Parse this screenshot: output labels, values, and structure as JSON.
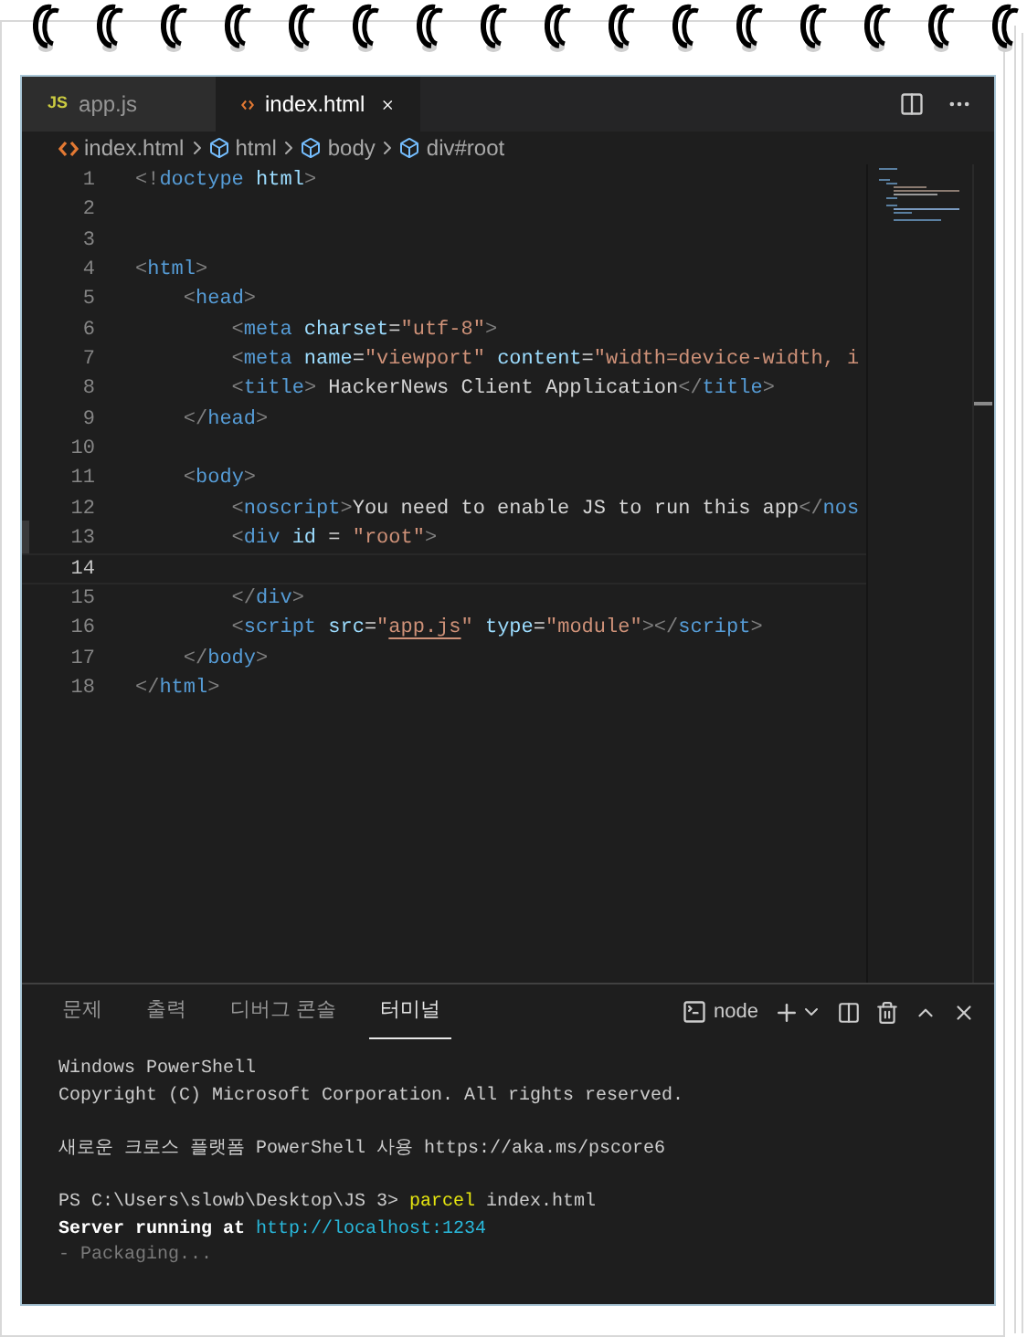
{
  "editor_tabs": [
    {
      "icon": "JS",
      "kind": "js",
      "label": "app.js",
      "selected": false
    },
    {
      "kind": "html",
      "label": "index.html",
      "selected": true
    }
  ],
  "breadcrumb": [
    {
      "kind": "file",
      "label": "index.html"
    },
    {
      "kind": "element",
      "label": "html"
    },
    {
      "kind": "element",
      "label": "body"
    },
    {
      "kind": "element",
      "label": "div#root"
    }
  ],
  "code_lines": [
    {
      "number": "1",
      "current": false,
      "tokens": [
        {
          "kind": "punct",
          "text": "<!"
        },
        {
          "kind": "tag",
          "text": "doctype"
        },
        {
          "kind": "attr",
          "text": " html"
        },
        {
          "kind": "punct",
          "text": ">"
        }
      ]
    },
    {
      "number": "2",
      "current": false
    },
    {
      "number": "3",
      "current": false
    },
    {
      "number": "4",
      "current": false,
      "tokens": [
        {
          "kind": "punct",
          "text": "<"
        },
        {
          "kind": "tag",
          "text": "html"
        },
        {
          "kind": "punct",
          "text": ">"
        }
      ]
    },
    {
      "number": "5",
      "current": false,
      "tokens": [
        {
          "kind": "punct",
          "text": "    <"
        },
        {
          "kind": "tag",
          "text": "head"
        },
        {
          "kind": "punct",
          "text": ">"
        }
      ]
    },
    {
      "number": "6",
      "current": false,
      "tokens": [
        {
          "kind": "punct",
          "text": "        <"
        },
        {
          "kind": "tag",
          "text": "meta"
        },
        {
          "kind": "attr",
          "text": " charset"
        },
        {
          "kind": "text",
          "text": "="
        },
        {
          "kind": "string",
          "text": "\"utf-8\""
        },
        {
          "kind": "punct",
          "text": ">"
        }
      ]
    },
    {
      "number": "7",
      "current": false,
      "tokens": [
        {
          "kind": "punct",
          "text": "        <"
        },
        {
          "kind": "tag",
          "text": "meta"
        },
        {
          "kind": "attr",
          "text": " name"
        },
        {
          "kind": "text",
          "text": "="
        },
        {
          "kind": "string",
          "text": "\"viewport\""
        },
        {
          "kind": "attr",
          "text": " content"
        },
        {
          "kind": "text",
          "text": "="
        },
        {
          "kind": "string",
          "text": "\"width=device-width, i"
        }
      ]
    },
    {
      "number": "8",
      "current": false,
      "tokens": [
        {
          "kind": "punct",
          "text": "        <"
        },
        {
          "kind": "tag",
          "text": "title"
        },
        {
          "kind": "punct",
          "text": ">"
        },
        {
          "kind": "text",
          "text": " HackerNews Client Application"
        },
        {
          "kind": "punct",
          "text": "</"
        },
        {
          "kind": "tag",
          "text": "title"
        },
        {
          "kind": "punct",
          "text": ">"
        }
      ]
    },
    {
      "number": "9",
      "current": false,
      "tokens": [
        {
          "kind": "punct",
          "text": "    </"
        },
        {
          "kind": "tag",
          "text": "head"
        },
        {
          "kind": "punct",
          "text": ">"
        }
      ]
    },
    {
      "number": "10",
      "current": false
    },
    {
      "number": "11",
      "current": false,
      "tokens": [
        {
          "kind": "punct",
          "text": "    <"
        },
        {
          "kind": "tag",
          "text": "body"
        },
        {
          "kind": "punct",
          "text": ">"
        }
      ]
    },
    {
      "number": "12",
      "current": false,
      "tokens": [
        {
          "kind": "punct",
          "text": "        <"
        },
        {
          "kind": "tag",
          "text": "noscript"
        },
        {
          "kind": "punct",
          "text": ">"
        },
        {
          "kind": "text",
          "text": "You need to enable JS to run this app"
        },
        {
          "kind": "punct",
          "text": "</"
        },
        {
          "kind": "tag",
          "text": "nos"
        }
      ]
    },
    {
      "number": "13",
      "current": false,
      "tokens": [
        {
          "kind": "punct",
          "text": "        <"
        },
        {
          "kind": "tag",
          "text": "div"
        },
        {
          "kind": "attr",
          "text": " id"
        },
        {
          "kind": "text",
          "text": " = "
        },
        {
          "kind": "string",
          "text": "\"root\""
        },
        {
          "kind": "punct",
          "text": ">"
        }
      ]
    },
    {
      "number": "14",
      "current": true
    },
    {
      "number": "15",
      "current": false,
      "tokens": [
        {
          "kind": "punct",
          "text": "        </"
        },
        {
          "kind": "tag",
          "text": "div"
        },
        {
          "kind": "punct",
          "text": ">"
        }
      ]
    },
    {
      "number": "16",
      "current": false,
      "tokens": [
        {
          "kind": "punct",
          "text": "        <"
        },
        {
          "kind": "tag",
          "text": "script"
        },
        {
          "kind": "attr",
          "text": " src"
        },
        {
          "kind": "text",
          "text": "="
        },
        {
          "kind": "string",
          "text": "\""
        },
        {
          "kind": "link",
          "text": "app.js"
        },
        {
          "kind": "string",
          "text": "\""
        },
        {
          "kind": "attr",
          "text": " type"
        },
        {
          "kind": "text",
          "text": "="
        },
        {
          "kind": "string",
          "text": "\"module\""
        },
        {
          "kind": "punct",
          "text": "></"
        },
        {
          "kind": "tag",
          "text": "script"
        },
        {
          "kind": "punct",
          "text": ">"
        }
      ]
    },
    {
      "number": "17",
      "current": false,
      "tokens": [
        {
          "kind": "punct",
          "text": "    </"
        },
        {
          "kind": "tag",
          "text": "body"
        },
        {
          "kind": "punct",
          "text": ">"
        }
      ]
    },
    {
      "number": "18",
      "current": false,
      "tokens": [
        {
          "kind": "punct",
          "text": "</"
        },
        {
          "kind": "tag",
          "text": "html"
        },
        {
          "kind": "punct",
          "text": ">"
        }
      ]
    }
  ],
  "panel_tabs": [
    {
      "label": "문제",
      "selected": false
    },
    {
      "label": "출력",
      "selected": false
    },
    {
      "label": "디버그 콘솔",
      "selected": false
    },
    {
      "label": "터미널",
      "selected": true
    }
  ],
  "terminal_name": "node",
  "terminal_lines": [
    {
      "kind": "line",
      "segments": [
        {
          "kind": "text",
          "text": "Windows PowerShell"
        }
      ]
    },
    {
      "kind": "line",
      "segments": [
        {
          "kind": "text",
          "text": "Copyright (C) Microsoft Corporation. All rights reserved."
        }
      ]
    },
    {
      "kind": "gap"
    },
    {
      "kind": "line",
      "segments": [
        {
          "kind": "text",
          "text": "새로운 크로스 플랫폼 PowerShell 사용 https://aka.ms/pscore6"
        }
      ]
    },
    {
      "kind": "gap"
    },
    {
      "kind": "line",
      "segments": [
        {
          "kind": "text",
          "text": "PS C:\\Users\\slowb\\Desktop\\JS 3> "
        },
        {
          "kind": "command",
          "text": "parcel"
        },
        {
          "kind": "text",
          "text": " index.html"
        }
      ]
    },
    {
      "kind": "line",
      "segments": [
        {
          "kind": "bold",
          "text": "Server running at "
        },
        {
          "kind": "link",
          "text": "http://localhost:1234"
        }
      ]
    },
    {
      "kind": "line",
      "segments": [
        {
          "kind": "dim",
          "text": "- Packaging..."
        }
      ]
    }
  ]
}
